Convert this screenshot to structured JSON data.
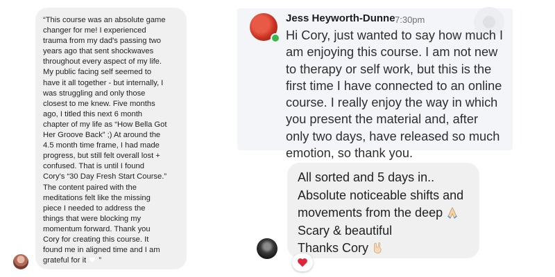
{
  "testimonial": {
    "lines": [
      "“This course was an absolute game",
      "changer for me! I experienced",
      "trauma from my dad's passing two",
      "years ago that sent shockwaves",
      "throughout every aspect of my life.",
      "My public facing self seemed to",
      "have it all together - but internally, I",
      "was struggling and only those",
      "closest to me knew. Five months",
      "ago, I titled this next 6 month",
      "chapter of my life as “How Bella Got",
      "Her Groove Back” ;) At around the",
      "4.5 month time frame, I had made",
      "progress, but still felt overall lost +",
      "confused. That is until I found",
      "Cory's “30 Day Fresh Start Course.”",
      "The content paired with the",
      "meditations felt like the missing",
      "piece I needed to address the",
      "things that were blocking my",
      "momentum forward. Thank you",
      "Cory for creating this course. It",
      "found me in aligned time and I am"
    ],
    "last_line_prefix": "grateful for it ",
    "last_line_suffix": " ”",
    "heart_icon": "white-heart-icon"
  },
  "jess_message": {
    "name": "Jess Heyworth-Dunne",
    "time": "7:30pm",
    "lines": [
      "Hi Cory, just wanted to say how much I",
      "am enjoying this course. I am not new",
      "to therapy or self work, but this is the",
      "first time I have connected to an online",
      "course. I really enjoy the way in which",
      "you present the material and, after",
      "only two days, have released so much",
      "emotion, so thank you."
    ],
    "online_color": "#3cb54a"
  },
  "cory_message": {
    "lines": [
      "All sorted and 5 days in..",
      "Absolute noticeable shifts and",
      "movements from the deep",
      "Scary & beautiful",
      "Thanks Cory"
    ],
    "prayer_icon": "folded-hands-icon",
    "rock_icon": "rock-on-hand-icon",
    "reaction_icon": "red-heart-icon",
    "reaction_color": "#e0243a"
  }
}
